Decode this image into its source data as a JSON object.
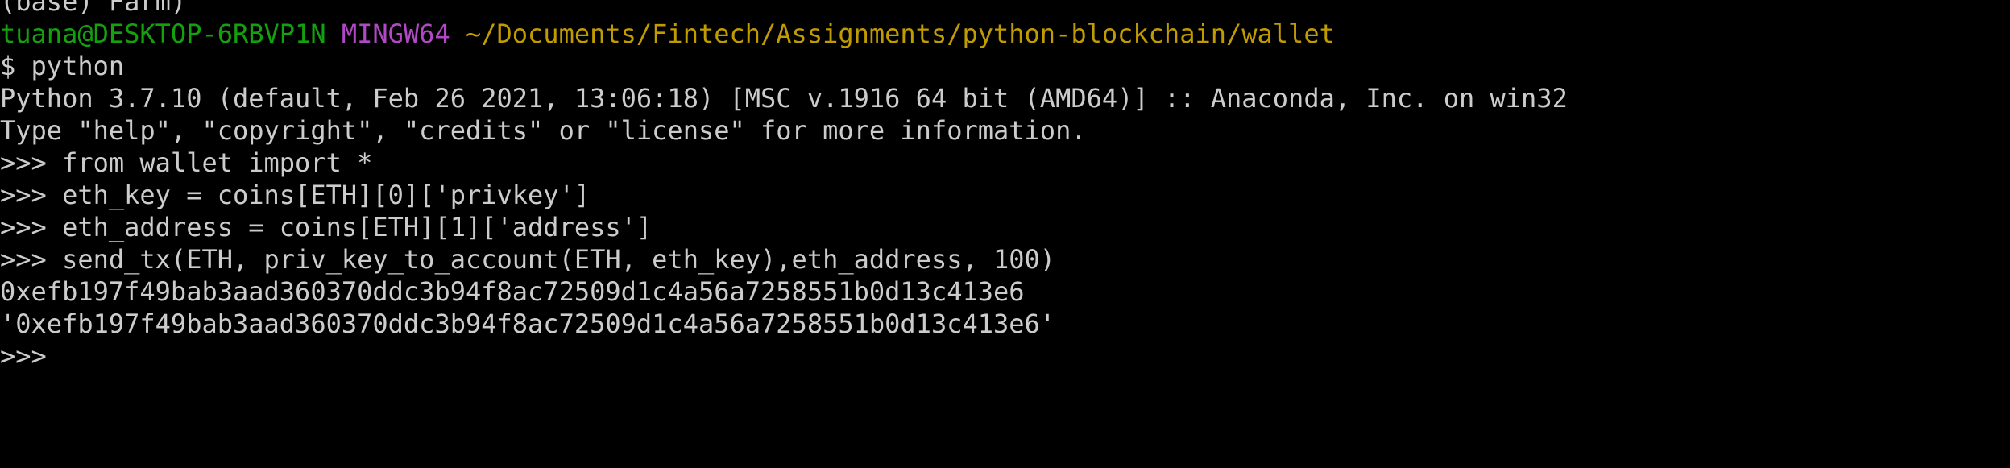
{
  "terminal": {
    "clipped_top_line": "(base) Farm)",
    "prompt": {
      "user_host": "tuana@DESKTOP-6RBVP1N",
      "shell": "MINGW64",
      "path": "~/Documents/Fintech/Assignments/python-blockchain/wallet"
    },
    "lines": [
      "$ python",
      "Python 3.7.10 (default, Feb 26 2021, 13:06:18) [MSC v.1916 64 bit (AMD64)] :: Anaconda, Inc. on win32",
      "Type \"help\", \"copyright\", \"credits\" or \"license\" for more information.",
      ">>> from wallet import *",
      ">>> eth_key = coins[ETH][0]['privkey']",
      ">>> eth_address = coins[ETH][1]['address']",
      ">>> send_tx(ETH, priv_key_to_account(ETH, eth_key),eth_address, 100)",
      "0xefb197f49bab3aad360370ddc3b94f8ac72509d1c4a56a7258551b0d13c413e6",
      "'0xefb197f49bab3aad360370ddc3b94f8ac72509d1c4a56a7258551b0d13c413e6'",
      ">>>"
    ],
    "colors": {
      "background": "#000000",
      "text": "#cccccc",
      "user_host": "#13a10e",
      "shell": "#b148c6",
      "path": "#c19c00"
    }
  }
}
